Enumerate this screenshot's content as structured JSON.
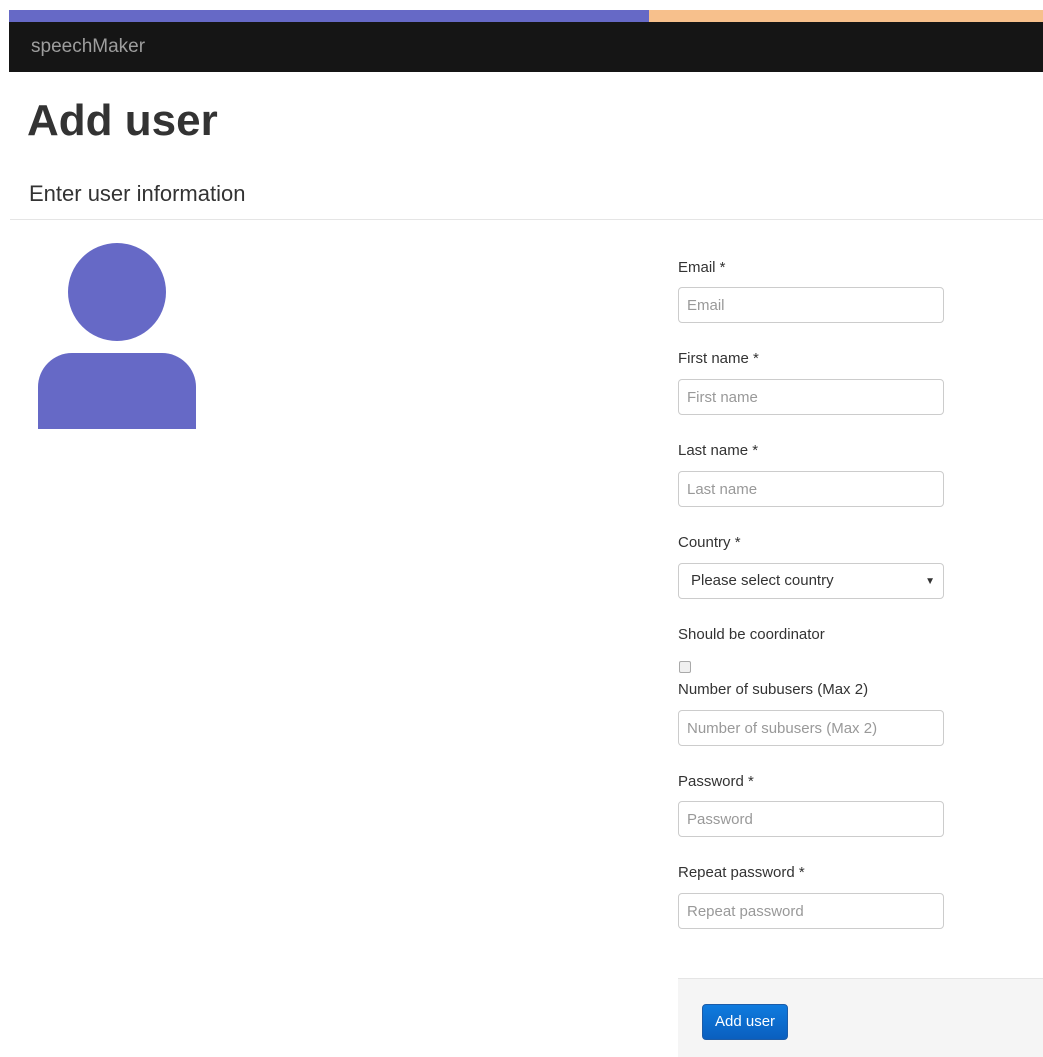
{
  "colors": {
    "accent_left": "#6669c6",
    "accent_right": "#f7c08c",
    "navbar_bg": "#151515",
    "avatar": "#6669c6",
    "button": "#0a6fd3"
  },
  "navbar": {
    "brand": "speechMaker"
  },
  "page": {
    "title": "Add user",
    "subtitle": "Enter user information"
  },
  "avatar": {
    "icon": "user-avatar-icon"
  },
  "form": {
    "email": {
      "label": "Email *",
      "placeholder": "Email",
      "value": ""
    },
    "first_name": {
      "label": "First name *",
      "placeholder": "First name",
      "value": ""
    },
    "last_name": {
      "label": "Last name *",
      "placeholder": "Last name",
      "value": ""
    },
    "country": {
      "label": "Country *",
      "selected": "Please select country",
      "arrow_icon": "caret-down-icon"
    },
    "coordinator": {
      "label": "Should be coordinator",
      "checked": false
    },
    "subusers": {
      "label": "Number of subusers (Max 2)",
      "placeholder": "Number of subusers (Max 2)",
      "value": ""
    },
    "password": {
      "label": "Password *",
      "placeholder": "Password",
      "value": ""
    },
    "repeat_password": {
      "label": "Repeat password *",
      "placeholder": "Repeat password",
      "value": ""
    },
    "submit_label": "Add user"
  }
}
